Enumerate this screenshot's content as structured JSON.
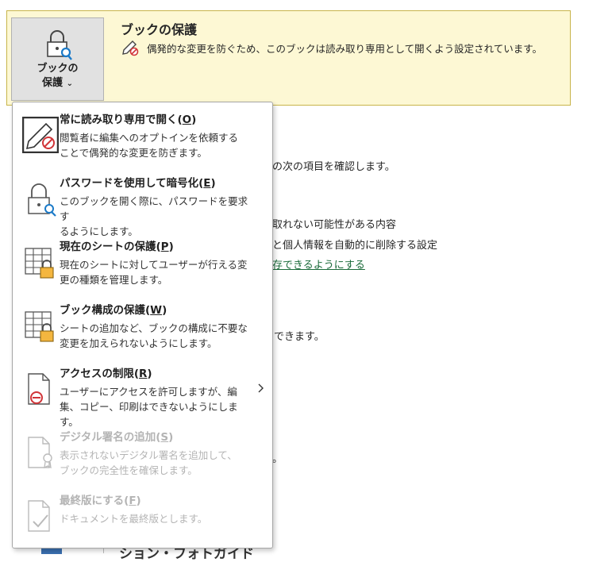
{
  "banner": {
    "button_label_line1": "ブックの",
    "button_label_line2": "保護",
    "title": "ブックの保護",
    "description": "偶発的な変更を防ぐため、このブックは読み取り専用として開くよう設定されています。"
  },
  "background": {
    "line1": "の次の項目を確認します。",
    "line2": "取れない可能性がある内容",
    "line3": "と個人情報を自動的に削除する設定",
    "link": "存できるようにする",
    "line4": "できます。",
    "line5": "。",
    "bottom": "ション・フォトガイド"
  },
  "menu": {
    "items": [
      {
        "title": "常に読み取り専用で開く(",
        "key": "O",
        "title_end": ")",
        "desc": "閲覧者に編集へのオプトインを依頼する\nことで偶発的な変更を防ぎます。",
        "icon": "read-only-pen-icon",
        "disabled": false
      },
      {
        "title": "パスワードを使用して暗号化(",
        "key": "E",
        "title_end": ")",
        "desc": "このブックを開く際に、パスワードを要求す\nるようにします。",
        "icon": "lock-key-icon",
        "disabled": false
      },
      {
        "title": "現在のシートの保護(",
        "key": "P",
        "title_end": ")",
        "desc": "現在のシートに対してユーザーが行える変\n更の種類を管理します。",
        "icon": "sheet-lock-icon",
        "disabled": false
      },
      {
        "title": "ブック構成の保護(",
        "key": "W",
        "title_end": ")",
        "desc": "シートの追加など、ブックの構成に不要な\n変更を加えられないようにします。",
        "icon": "workbook-lock-icon",
        "disabled": false
      },
      {
        "title": "アクセスの制限(",
        "key": "R",
        "title_end": ")",
        "desc": "ユーザーにアクセスを許可しますが、編\n集、コピー、印刷はできないようにします。",
        "icon": "restrict-access-icon",
        "disabled": false
      },
      {
        "title": "デジタル署名の追加(",
        "key": "S",
        "title_end": ")",
        "desc": "表示されないデジタル署名を追加して、\nブックの完全性を確保します。",
        "icon": "signature-ribbon-icon",
        "disabled": true
      },
      {
        "title": "最終版にする(",
        "key": "F",
        "title_end": ")",
        "desc": "ドキュメントを最終版とします。",
        "icon": "mark-final-icon",
        "disabled": true
      }
    ]
  }
}
